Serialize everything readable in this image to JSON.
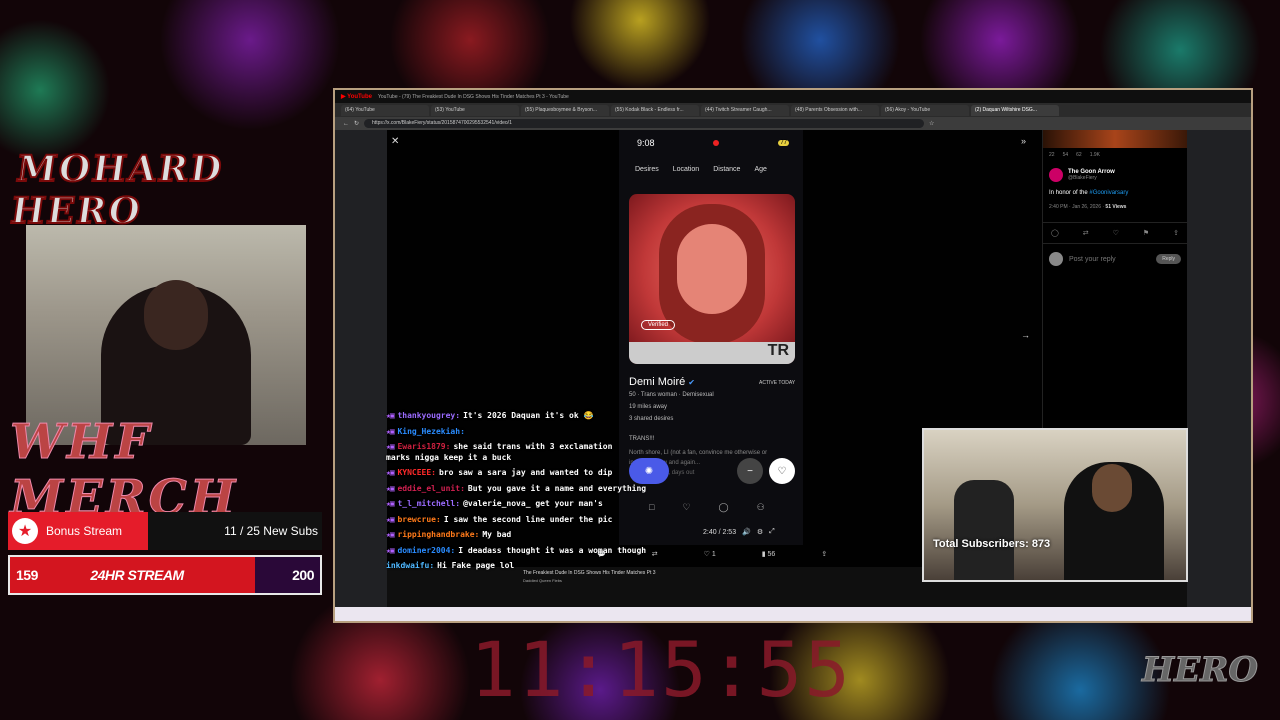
{
  "overlay": {
    "logo_text": "MOHARD HERO",
    "merch_text": "WHF MERCH",
    "bonus_stream_label": "Bonus Stream",
    "bonus_sub_count": "11 / 25 New Subs",
    "stream_bar": {
      "left_value": "159",
      "title": "24HR STREAM",
      "right_value": "200",
      "progress": 0.79
    },
    "clock": "11:15:55",
    "total_subscribers": "Total Subscribers: 873"
  },
  "browser": {
    "title": "YouTube - (79) The Freakiest Dude In DSG Shows His Tinder Matches Pt 3 - YouTube",
    "tabs": [
      {
        "label": "(64) YouTube"
      },
      {
        "label": "(53) YouTube"
      },
      {
        "label": "(55) Plaquesboymee & Bryson..."
      },
      {
        "label": "(55) Kodak Black - Endless fr..."
      },
      {
        "label": "(44) Twitch Streamer Caugh..."
      },
      {
        "label": "(48) Parents Obsession with..."
      },
      {
        "label": "(56) Akoy - YouTube"
      },
      {
        "label": "(2) Daquan Wiltshire DSG..."
      }
    ],
    "url": "https://x.com/BlakeFiery/status/2015874700295532541/video/1"
  },
  "video": {
    "time": "9:08",
    "battery": "77",
    "filters": [
      "Desires",
      "Location",
      "Distance",
      "Age"
    ],
    "verified_label": "Verified",
    "profile_name": "Demi Moiré",
    "active_label": "ACTIVE TODAY",
    "details": "50 · Trans woman · Demisexual",
    "distance": "19 miles away",
    "shared": "3 shared desires",
    "bio_line1": "TRANS!!!",
    "bio_line2": "North shore, LI (not a fan, convince me otherwise or",
    "bio_line3": "in the city now and again...",
    "bio_line4": "Love going out, days out",
    "playback_time": "2:40 / 2:53",
    "reply_count": "",
    "like_count": "1",
    "view_count": "56"
  },
  "tweet": {
    "stats": [
      "22",
      "54",
      "62",
      "1.9K"
    ],
    "author_name": "The Goon Arrow",
    "author_handle": "@BlakeFiery",
    "text_prefix": "In honor of the ",
    "hashtag": "#Goonivarsary",
    "date": "2:40 PM · Jan 26, 2026 · ",
    "views": "51 Views",
    "reply_placeholder": "Post your reply",
    "reply_button": "Reply"
  },
  "youtube": {
    "video_title": "The Freakiest Dude In DSG Shows His Tinder Matches Pt 3",
    "channel": "Daddied Queen Fiebs"
  },
  "chat": [
    {
      "user": "thankyougrey:",
      "color": "#9b6bff",
      "text": "It's 2026 Daquan it's ok 😂"
    },
    {
      "user": "King_Hezekiah:",
      "color": "#2a8cff",
      "text": ""
    },
    {
      "user": "Ewaris1879:",
      "color": "#d02040",
      "text": "she said trans with 3 exclamation marks nigga keep it a buck"
    },
    {
      "user": "KYNCEEE:",
      "color": "#ff2a2a",
      "text": "bro saw a sara jay and wanted to dip"
    },
    {
      "user": "eddie_el_unit:",
      "color": "#d02050",
      "text": "But you gave it a name and everything"
    },
    {
      "user": "t_l_mitchell:",
      "color": "#9b6bff",
      "text": "@valerie_nova_ get your man's"
    },
    {
      "user": "brewcrue:",
      "color": "#ff7a1a",
      "text": "I saw the second line under the pic"
    },
    {
      "user": "rippinghandbrake:",
      "color": "#ff7a1a",
      "text": "My bad"
    },
    {
      "user": "dominer2004:",
      "color": "#2a8cff",
      "text": "I deadass thought it was a woman though"
    },
    {
      "user": "inkdwaifu:",
      "color": "#4fb8ff",
      "text": "Hi Fake page lol"
    }
  ]
}
